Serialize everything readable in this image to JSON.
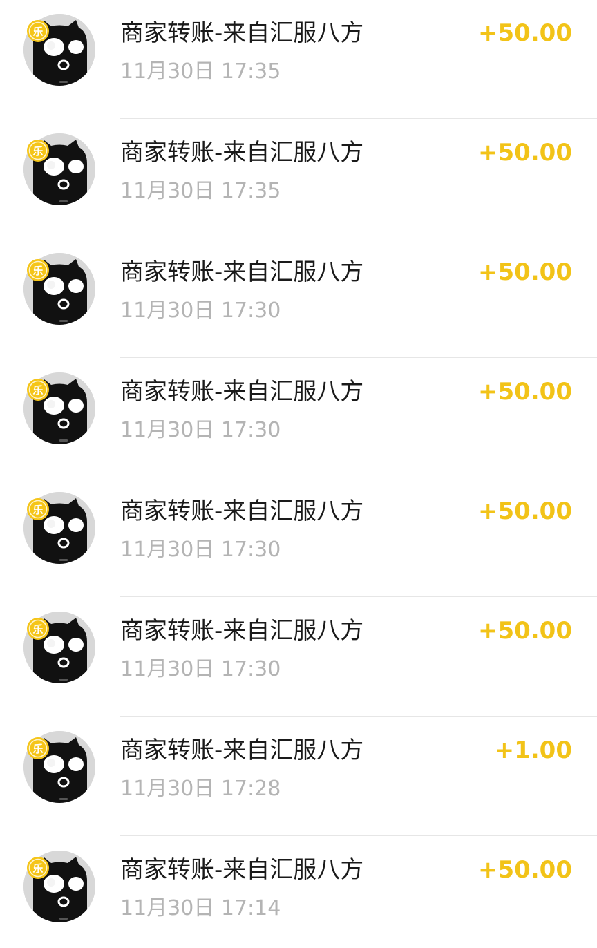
{
  "transactions": [
    {
      "title": "商家转账-来自汇服八方",
      "time": "11月30日 17:35",
      "amount": "+50.00"
    },
    {
      "title": "商家转账-来自汇服八方",
      "time": "11月30日 17:35",
      "amount": "+50.00"
    },
    {
      "title": "商家转账-来自汇服八方",
      "time": "11月30日 17:30",
      "amount": "+50.00"
    },
    {
      "title": "商家转账-来自汇服八方",
      "time": "11月30日 17:30",
      "amount": "+50.00"
    },
    {
      "title": "商家转账-来自汇服八方",
      "time": "11月30日 17:30",
      "amount": "+50.00"
    },
    {
      "title": "商家转账-来自汇服八方",
      "time": "11月30日 17:30",
      "amount": "+50.00"
    },
    {
      "title": "商家转账-来自汇服八方",
      "time": "11月30日 17:28",
      "amount": "+1.00"
    },
    {
      "title": "商家转账-来自汇服八方",
      "time": "11月30日 17:14",
      "amount": "+50.00"
    }
  ],
  "avatar_badge": "乐",
  "colors": {
    "amount": "#f2c318",
    "title": "#1a1a1a",
    "time": "#b4b4b4",
    "divider": "#e6e6e6",
    "avatar_bg": "#d8d8d8",
    "avatar_character": "#111111",
    "badge": "#f5c518"
  },
  "icons": {
    "avatar": "black-cartoon-cat-avatar-icon",
    "badge": "yellow-coin-badge-icon"
  }
}
